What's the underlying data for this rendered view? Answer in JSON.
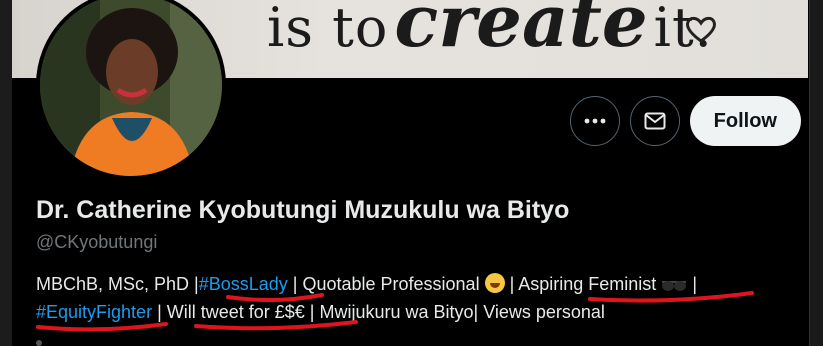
{
  "banner": {
    "text_plain_1": "is to",
    "text_script": "create",
    "text_plain_2": "it."
  },
  "actions": {
    "more_icon": "more-horizontal",
    "message_icon": "envelope",
    "follow_label": "Follow"
  },
  "profile": {
    "display_name": "Dr. Catherine Kyobutungi Muzukulu wa Bityo",
    "handle": "@CKyobutungi",
    "bio": {
      "part1": "MBChB, MSc, PhD |",
      "tag1": "#BossLady",
      "part2": " | Quotable Professional ",
      "part3": " | Aspiring Feminist ",
      "part4": " | ",
      "tag2": "#EquityFighter",
      "part5": " | Will tweet for £$€ | Mwijukuru wa Bityo| Views personal"
    }
  },
  "colors": {
    "link": "#1d9bf0",
    "annotation": "#e0141e",
    "follow_bg": "#eff3f4"
  }
}
